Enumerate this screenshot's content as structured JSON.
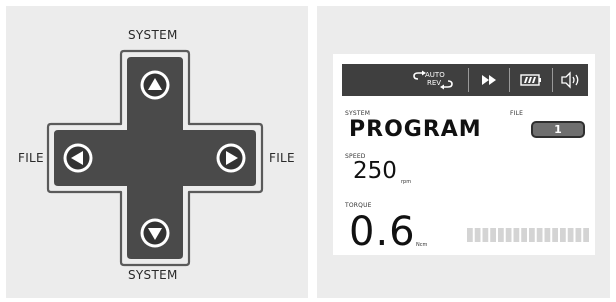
{
  "dpad": {
    "top_label": "SYSTEM",
    "bottom_label": "SYSTEM",
    "left_label": "FILE",
    "right_label": "FILE"
  },
  "display": {
    "toolbar": {
      "auto_rev_top": "AUTO",
      "auto_rev_bottom": "REV",
      "icons": [
        "auto-reverse-icon",
        "fast-forward-icon",
        "battery-icon",
        "speaker-icon"
      ]
    },
    "system_label": "SYSTEM",
    "system_value": "PROGRAM",
    "file_label": "FILE",
    "file_value": "1",
    "speed_label": "SPEED",
    "speed_value": "250",
    "speed_unit": "rpm",
    "torque_label": "TORQUE",
    "torque_value": "0.6",
    "torque_unit": "Ncm",
    "torque_bar_segments": 16,
    "torque_bar_filled": 0
  },
  "colors": {
    "panel_bg": "#ececec",
    "dpad_fill": "#4a4a4a",
    "toolbar_bg": "#3f3f3f",
    "bar_segment": "#d4d4d4"
  }
}
